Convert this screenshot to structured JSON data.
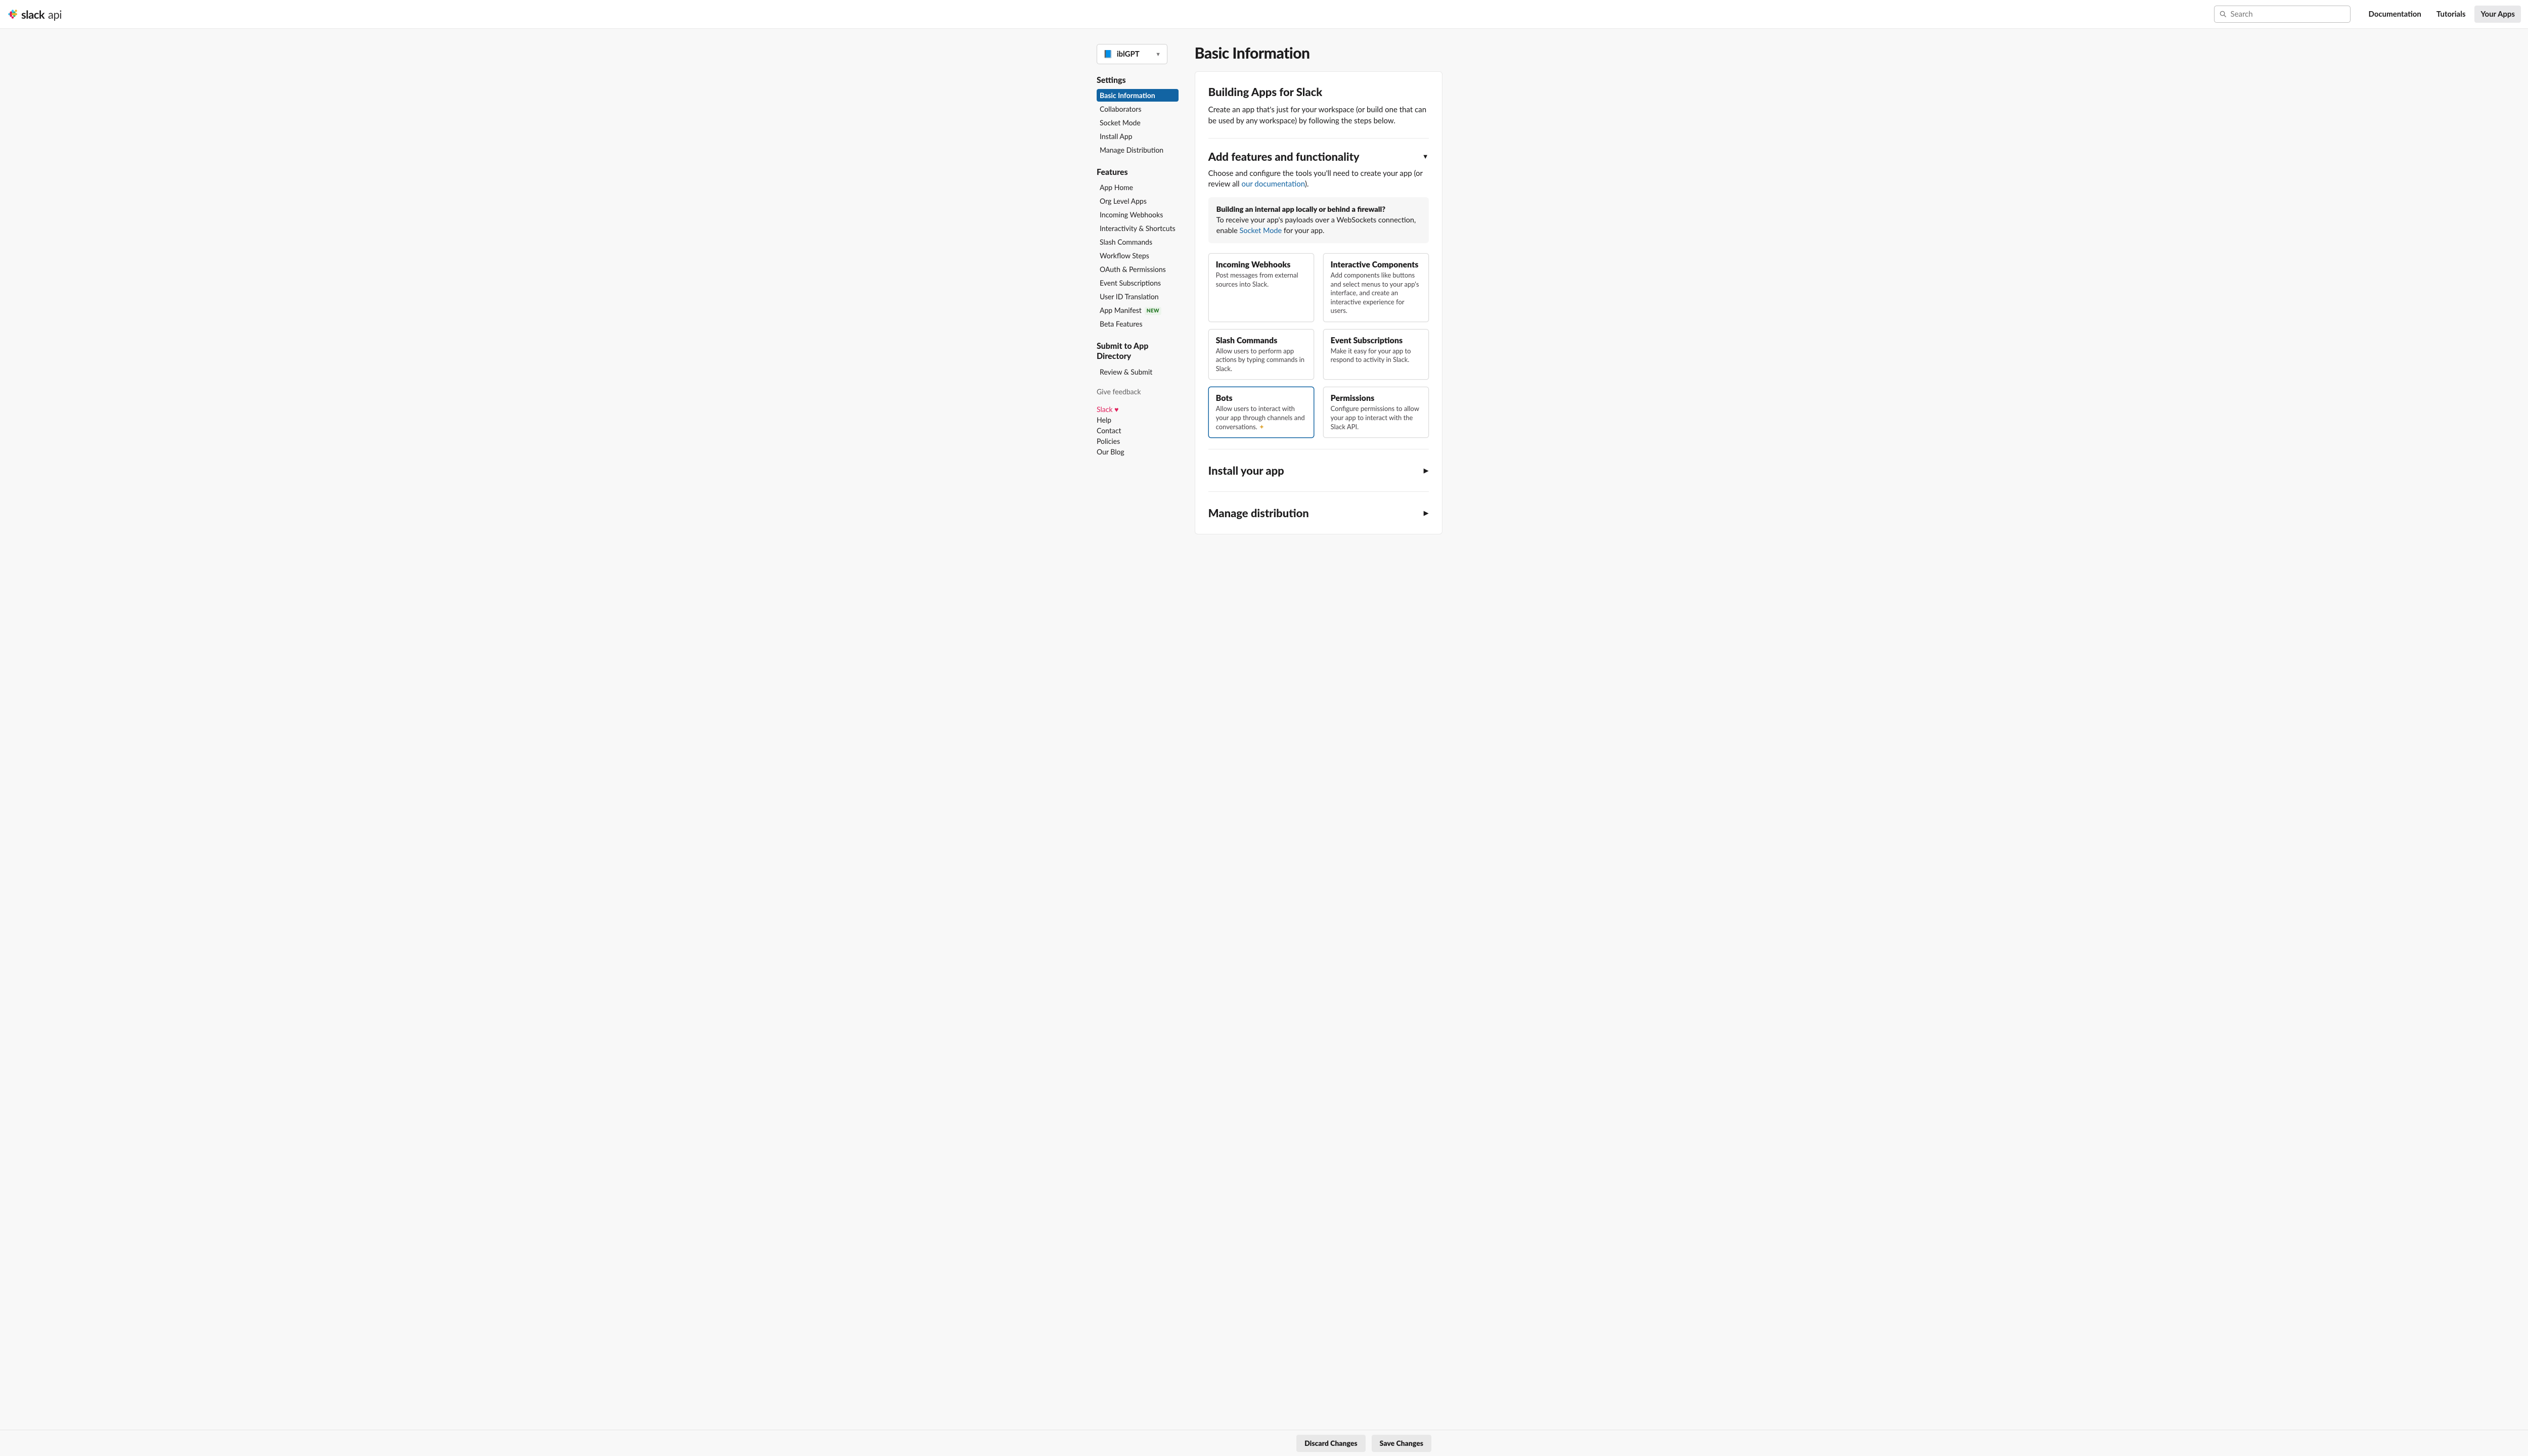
{
  "header": {
    "brand": "slack",
    "brand_suffix": "api",
    "search_placeholder": "Search",
    "links": [
      "Documentation",
      "Tutorials",
      "Your Apps"
    ],
    "active_link": 2
  },
  "app_selector": {
    "name": "iblGPT"
  },
  "sidebar": {
    "sections": [
      {
        "title": "Settings",
        "items": [
          {
            "label": "Basic Information",
            "active": true
          },
          {
            "label": "Collaborators"
          },
          {
            "label": "Socket Mode"
          },
          {
            "label": "Install App"
          },
          {
            "label": "Manage Distribution"
          }
        ]
      },
      {
        "title": "Features",
        "items": [
          {
            "label": "App Home"
          },
          {
            "label": "Org Level Apps"
          },
          {
            "label": "Incoming Webhooks"
          },
          {
            "label": "Interactivity & Shortcuts"
          },
          {
            "label": "Slash Commands"
          },
          {
            "label": "Workflow Steps"
          },
          {
            "label": "OAuth & Permissions"
          },
          {
            "label": "Event Subscriptions"
          },
          {
            "label": "User ID Translation"
          },
          {
            "label": "App Manifest",
            "badge": "NEW"
          },
          {
            "label": "Beta Features"
          }
        ]
      },
      {
        "title": "Submit to App Directory",
        "items": [
          {
            "label": "Review & Submit"
          }
        ]
      }
    ],
    "feedback": "Give feedback",
    "footer": [
      "Slack ",
      "Help",
      "Contact",
      "Policies",
      "Our Blog"
    ]
  },
  "main": {
    "page_title": "Basic Information",
    "h2": "Building Apps for Slack",
    "intro": "Create an app that's just for your workspace (or build one that can be used by any workspace) by following the steps below.",
    "section1_title": "Add features and functionality",
    "section1_text_a": "Choose and configure the tools you'll need to create your app (or review all ",
    "section1_link": "our documentation",
    "section1_text_b": ").",
    "infobox_title": "Building an internal app locally or behind a firewall?",
    "infobox_a": "To receive your app's payloads over a WebSockets connection, enable ",
    "infobox_link": "Socket Mode",
    "infobox_b": " for your app.",
    "features": [
      {
        "title": "Incoming Webhooks",
        "desc": "Post messages from external sources into Slack."
      },
      {
        "title": "Interactive Components",
        "desc": "Add components like buttons and select menus to your app's interface, and create an interactive experience for users."
      },
      {
        "title": "Slash Commands",
        "desc": "Allow users to perform app actions by typing commands in Slack."
      },
      {
        "title": "Event Subscriptions",
        "desc": "Make it easy for your app to respond to activity in Slack."
      },
      {
        "title": "Bots",
        "desc": "Allow users to interact with your app through channels and conversations. ",
        "highlight": true,
        "sparkle": true
      },
      {
        "title": "Permissions",
        "desc": "Configure permissions to allow your app to interact with the Slack API."
      }
    ],
    "section2_title": "Install your app",
    "section3_title": "Manage distribution"
  },
  "footer": {
    "discard": "Discard Changes",
    "save": "Save Changes"
  }
}
